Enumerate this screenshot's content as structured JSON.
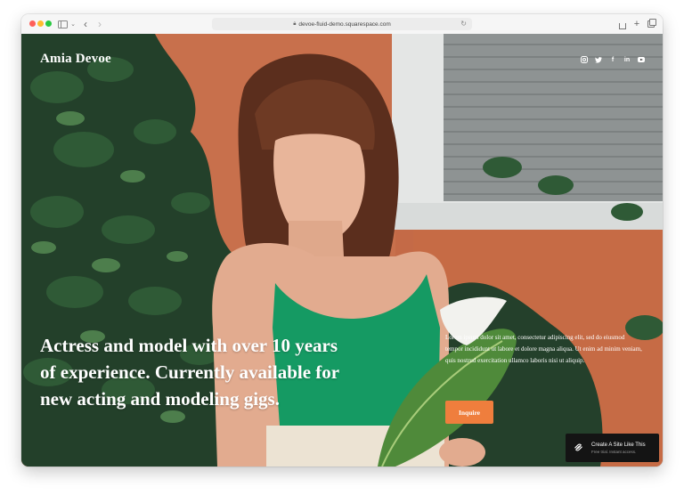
{
  "browser": {
    "url": "devoe-fluid-demo.squarespace.com"
  },
  "site": {
    "title": "Amia Devoe",
    "social_icons": [
      "instagram-icon",
      "twitter-icon",
      "facebook-icon",
      "linkedin-icon",
      "youtube-icon"
    ]
  },
  "hero": {
    "headline": "Actress and model with over 10 years of experience. Currently available for new acting and modeling gigs.",
    "body": "Lorem ipsum dolor sit amet, consectetur adipiscing elit, sed do eiusmod tempor incididunt ut labore et dolore magna aliqua. Ut enim ad minim veniam, quis nostrud exercitation ullamco laboris nisi ut aliquip.",
    "button_label": "Inquire"
  },
  "badge": {
    "title": "Create A Site Like This",
    "subtitle": "Free trial. Instant access."
  },
  "colors": {
    "button": "#ef7e3d",
    "wall": "#c46a47",
    "dress": "#159a63"
  }
}
